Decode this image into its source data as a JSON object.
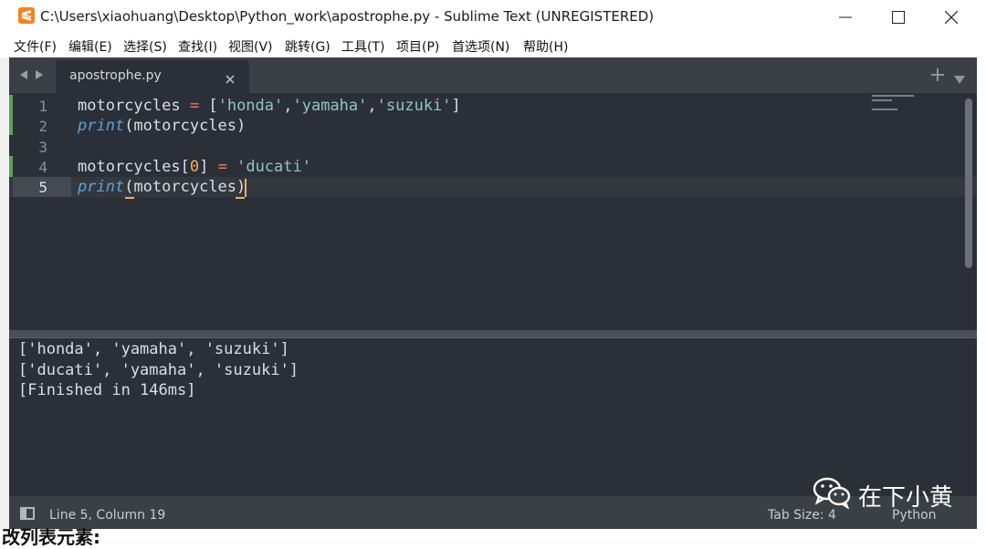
{
  "window": {
    "title": "C:\\Users\\xiaohuang\\Desktop\\Python_work\\apostrophe.py - Sublime Text (UNREGISTERED)",
    "app_icon": "sublime-text-icon",
    "controls": [
      "minimize-icon",
      "maximize-icon",
      "close-icon"
    ]
  },
  "menu": {
    "items": [
      "文件(F)",
      "编辑(E)",
      "选择(S)",
      "查找(I)",
      "视图(V)",
      "跳转(G)",
      "工具(T)",
      "项目(P)",
      "首选项(N)",
      "帮助(H)"
    ]
  },
  "tabs": {
    "active": "apostrophe.py",
    "close_glyph": "×",
    "new_tab_glyph": "+"
  },
  "editor": {
    "line_numbers": [
      "1",
      "2",
      "3",
      "4",
      "5"
    ],
    "lines": [
      {
        "t": "motorcycles = ['honda','yamaha','suzuki']"
      },
      {
        "t": "print(motorcycles)"
      },
      {
        "t": ""
      },
      {
        "t": "motorcycles[0] = 'ducati'"
      },
      {
        "t": "print(motorcycles)"
      }
    ],
    "tokens": {
      "var": "motorcycles",
      "eq": "=",
      "lb": "[",
      "rb": "]",
      "s1": "'honda'",
      "s2": "'yamaha'",
      "s3": "'suzuki'",
      "comma": ",",
      "kw": "print",
      "paren_open": "(",
      "paren_close": ")",
      "idx": "0",
      "s4": "'ducati'",
      "space": " "
    },
    "colors": {
      "background": "#2b3038",
      "keyword": "#5f9fd8",
      "operator": "#f97b58",
      "string": "#8fc6bf",
      "number": "#f9ae58"
    }
  },
  "output": {
    "lines": [
      "['honda', 'yamaha', 'suzuki']",
      "['ducati', 'yamaha', 'suzuki']",
      "[Finished in 146ms]"
    ]
  },
  "status": {
    "position": "Line 5, Column 19",
    "tab_size": "Tab Size: 4",
    "syntax": "Python"
  },
  "watermark": {
    "icon": "wechat-icon",
    "text": "在下小黄"
  },
  "bottom_fragment": "改列表元素:"
}
